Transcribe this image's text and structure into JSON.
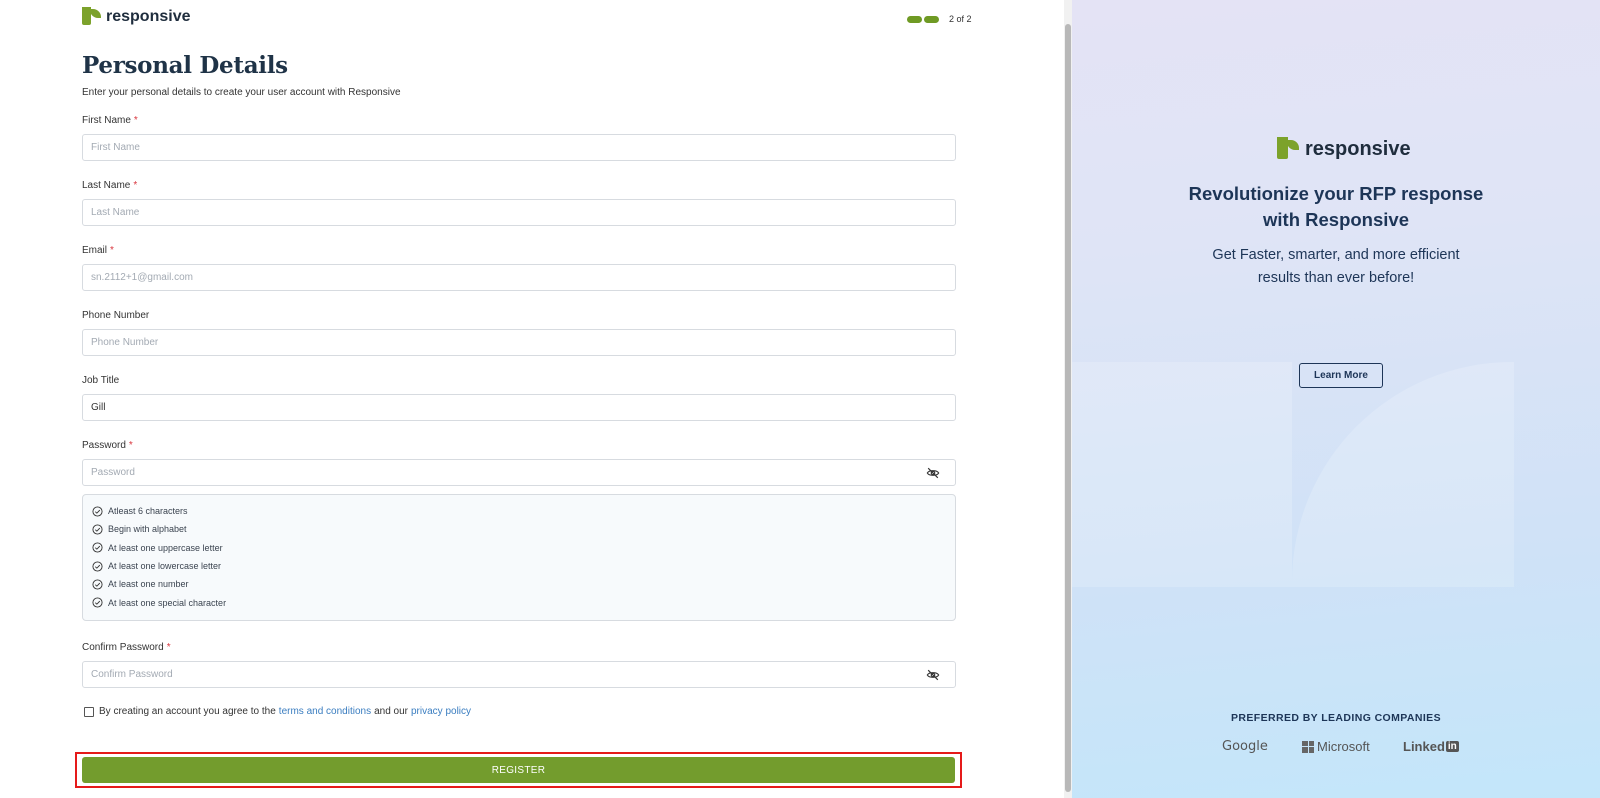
{
  "form": {
    "brand": "responsive",
    "step_label": "2 of 2",
    "title": "Personal Details",
    "subtitle": "Enter your personal details to create your user account with Responsive",
    "required_mark": "*",
    "first_name": {
      "label": "First Name",
      "placeholder": "First Name",
      "value": ""
    },
    "last_name": {
      "label": "Last Name",
      "placeholder": "Last Name",
      "value": ""
    },
    "email": {
      "label": "Email",
      "placeholder": "sn.2112+1@gmail.com",
      "value": ""
    },
    "phone": {
      "label": "Phone Number",
      "placeholder": "Phone Number",
      "value": ""
    },
    "job_title": {
      "label": "Job Title",
      "placeholder": "",
      "value": "Gill"
    },
    "password": {
      "label": "Password",
      "placeholder": "Password",
      "value": ""
    },
    "password_rules": [
      "Atleast 6 characters",
      "Begin with alphabet",
      "At least one uppercase letter",
      "At least one lowercase letter",
      "At least one number",
      "At least one special character"
    ],
    "confirm_password": {
      "label": "Confirm Password",
      "placeholder": "Confirm Password",
      "value": ""
    },
    "agreement": {
      "prefix": "By creating an account you agree to the",
      "terms_link": "terms and conditions",
      "middle": "and our",
      "privacy_link": "privacy policy"
    },
    "register_label": "REGISTER"
  },
  "promo": {
    "brand": "responsive",
    "headline_line1": "Revolutionize your RFP response",
    "headline_line2": "with Responsive",
    "sub_line1": "Get Faster, smarter, and more efficient",
    "sub_line2": "results than ever before!",
    "learn_more": "Learn More",
    "preferred": "PREFERRED BY LEADING COMPANIES",
    "companies": {
      "google": "Google",
      "microsoft": "Microsoft",
      "linkedin_text": "Linked",
      "linkedin_box": "in"
    }
  },
  "colors": {
    "accent_green": "#739c2d",
    "link_blue": "#3a7dc0",
    "navy": "#1d3557",
    "required_red": "#d9363e",
    "highlight_red": "#e51a1a"
  },
  "icons": {
    "eye": "eye-off-icon",
    "rule": "check-circle-icon",
    "logo": "responsive-logo-icon"
  }
}
